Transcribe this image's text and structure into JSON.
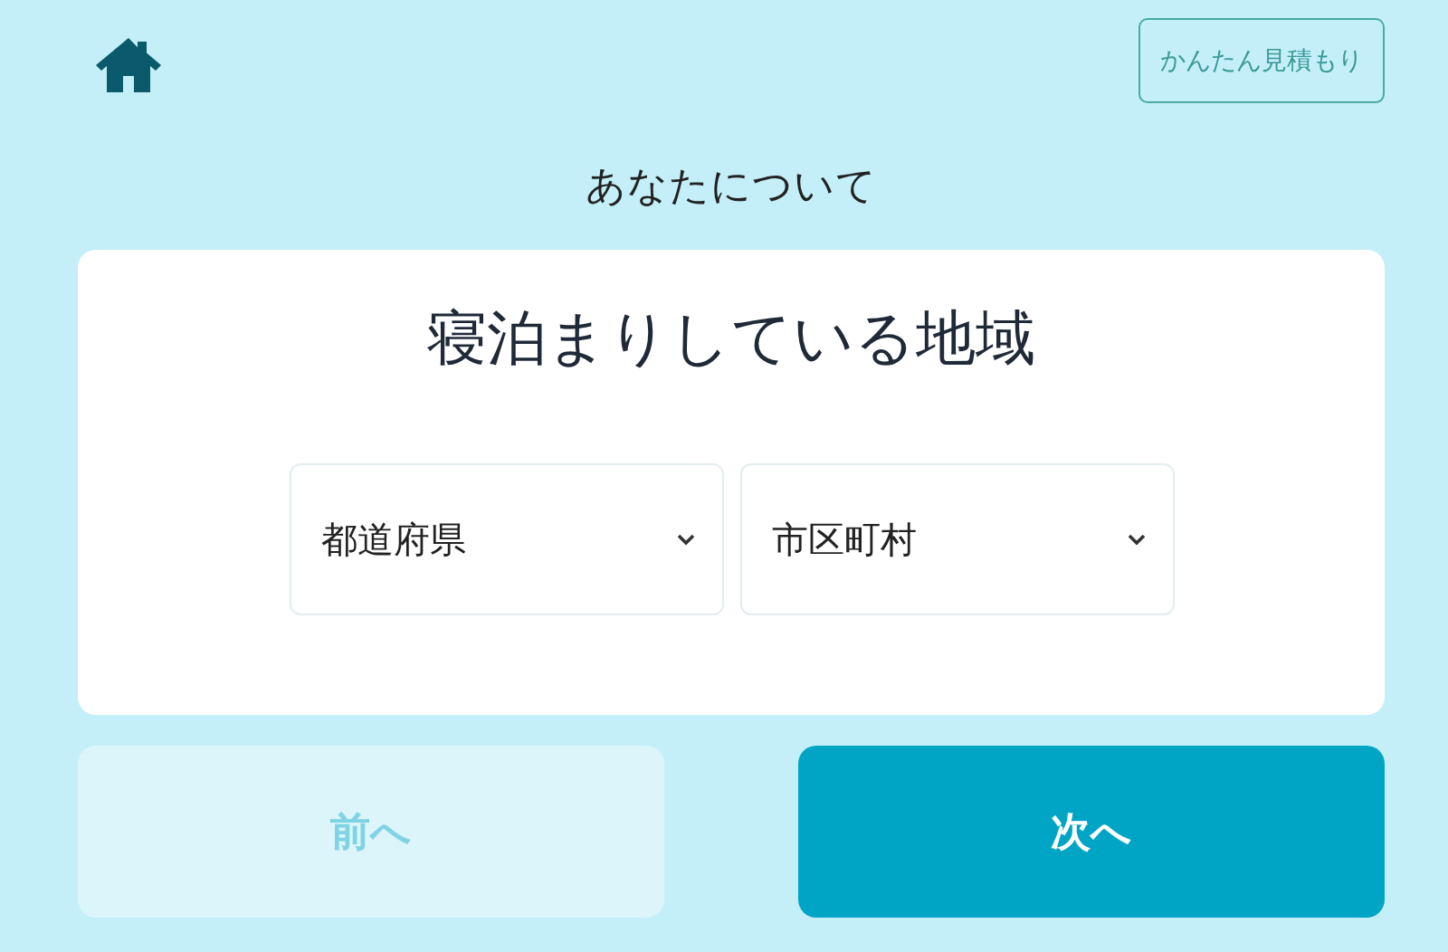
{
  "header": {
    "estimate_button": "かんたん見積もり"
  },
  "section_title": "あなたについて",
  "card": {
    "title": "寝泊まりしている地域",
    "selects": [
      {
        "placeholder": "都道府県"
      },
      {
        "placeholder": "市区町村"
      }
    ]
  },
  "nav_buttons": [
    {
      "label": "前へ",
      "disabled": true
    },
    {
      "label": "次へ",
      "disabled": false
    }
  ]
}
